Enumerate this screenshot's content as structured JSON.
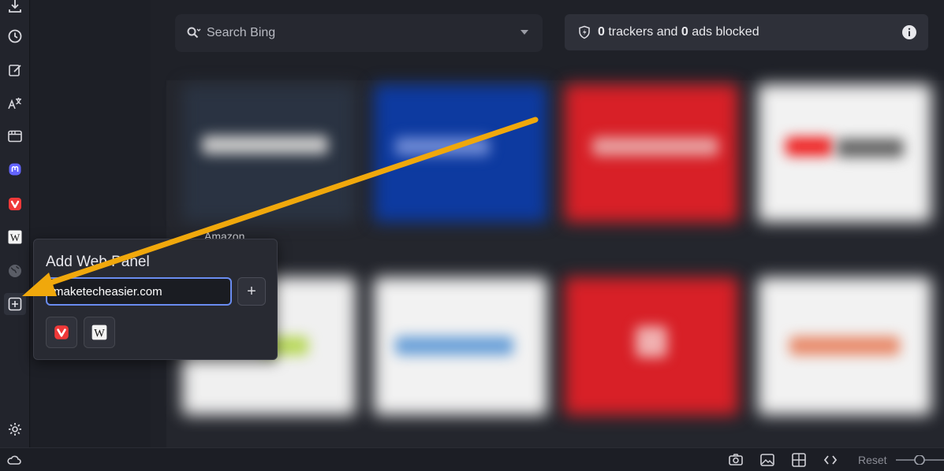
{
  "sidebar": {
    "items": [
      {
        "name": "downloads-icon"
      },
      {
        "name": "history-icon"
      },
      {
        "name": "notes-icon"
      },
      {
        "name": "translate-icon"
      },
      {
        "name": "window-panel-icon"
      },
      {
        "name": "mastodon-icon"
      },
      {
        "name": "vivaldi-icon"
      },
      {
        "name": "wikipedia-icon"
      },
      {
        "name": "globe-icon"
      },
      {
        "name": "add-web-panel-icon"
      }
    ],
    "settings_icon": "gear-icon"
  },
  "search": {
    "placeholder": "Search Bing"
  },
  "tracker": {
    "trackers_count": "0",
    "trackers_text": " trackers and ",
    "ads_count": "0",
    "ads_text": " ads blocked"
  },
  "speed_dial": {
    "first_label": "Amazon"
  },
  "popup": {
    "title": "Add Web Panel",
    "url_value": "maketecheasier.com",
    "add_label": "+",
    "suggestions": [
      "vivaldi-icon",
      "wikipedia-icon"
    ]
  },
  "status_bar": {
    "reset_label": "Reset"
  },
  "colors": {
    "accent": "#6a8cf0",
    "arrow": "#f0a80c",
    "vivaldi_red": "#ef3939",
    "mastodon_purple": "#6364ff"
  }
}
